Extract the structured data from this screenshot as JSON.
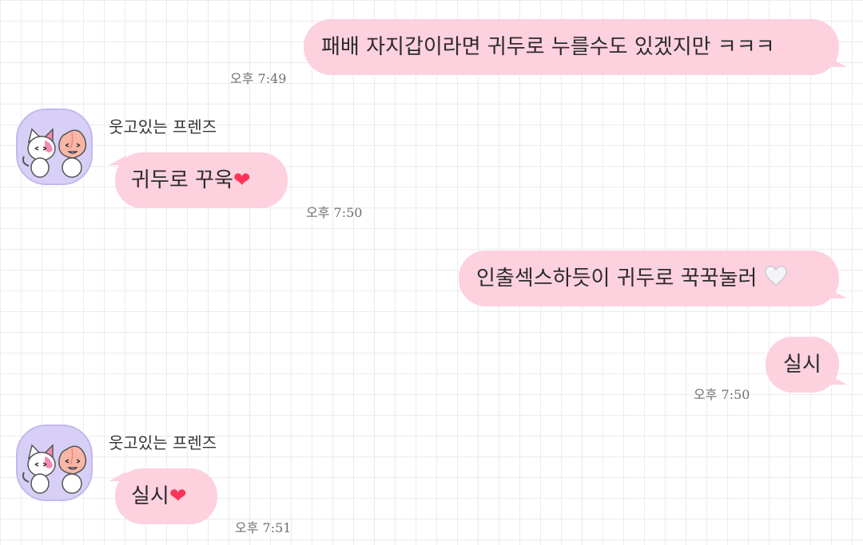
{
  "messages": [
    {
      "sender": "me",
      "text": "패배 자지갑이라면 귀두로 누를수도 있겠지만 ㅋㅋㅋ",
      "time": "오후 7:49"
    },
    {
      "sender": "웃고있는 프렌즈",
      "text": "귀두로 꾸욱",
      "emoji": "❤",
      "time": "오후 7:50"
    },
    {
      "sender": "me",
      "text": "인출섹스하듯이 귀두로 꾹꾹눌러",
      "emoji": "white-heart-icon"
    },
    {
      "sender": "me",
      "text": "실시",
      "time": "오후 7:50"
    },
    {
      "sender": "웃고있는 프렌즈",
      "text": "실시",
      "emoji": "❤",
      "time": "오후 7:51"
    }
  ],
  "colors": {
    "bubble": "#fdd1de",
    "avatar_bg": "#d8cff6",
    "heart": "#ff3355",
    "time_text": "#707070"
  }
}
